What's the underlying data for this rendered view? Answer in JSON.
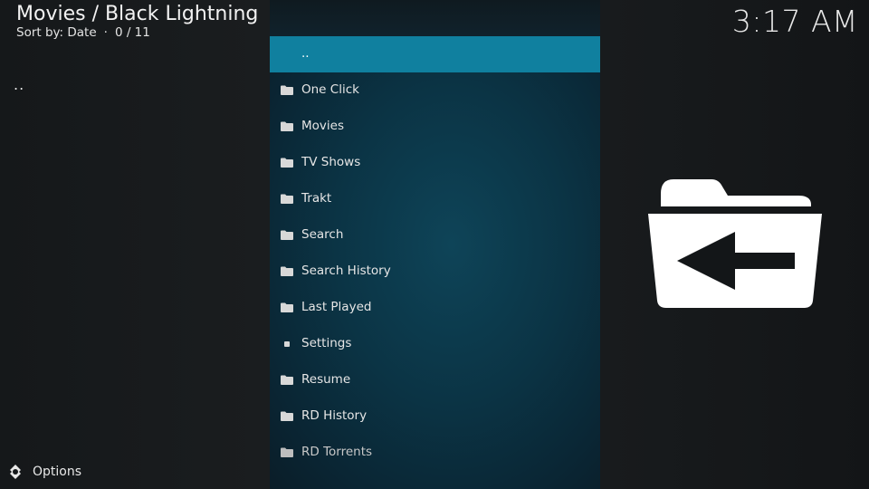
{
  "header": {
    "title": "Movies / Black Lightning",
    "sort_label": "Sort by: Date",
    "separator": "·",
    "count": "0 / 11",
    "clock": "3:17 AM"
  },
  "left_panel": {
    "parent_marker": ".."
  },
  "list": {
    "items": [
      {
        "label": "..",
        "icon": "none"
      },
      {
        "label": "One Click",
        "icon": "folder-icon"
      },
      {
        "label": "Movies",
        "icon": "folder-icon"
      },
      {
        "label": "TV Shows",
        "icon": "folder-icon"
      },
      {
        "label": "Trakt",
        "icon": "folder-icon"
      },
      {
        "label": "Search",
        "icon": "folder-icon"
      },
      {
        "label": "Search History",
        "icon": "folder-icon"
      },
      {
        "label": "Last Played",
        "icon": "folder-icon"
      },
      {
        "label": "Settings",
        "icon": "square-icon"
      },
      {
        "label": "Resume",
        "icon": "folder-icon"
      },
      {
        "label": "RD History",
        "icon": "folder-icon"
      },
      {
        "label": "RD Torrents",
        "icon": "folder-icon"
      }
    ],
    "focused_index": 0
  },
  "preview": {
    "icon": "folder-back-icon"
  },
  "footer": {
    "options_label": "Options",
    "options_icon": "gear-icon"
  },
  "colors": {
    "focus": "#10809f",
    "panel": "#0b3445",
    "background": "#15181a"
  }
}
